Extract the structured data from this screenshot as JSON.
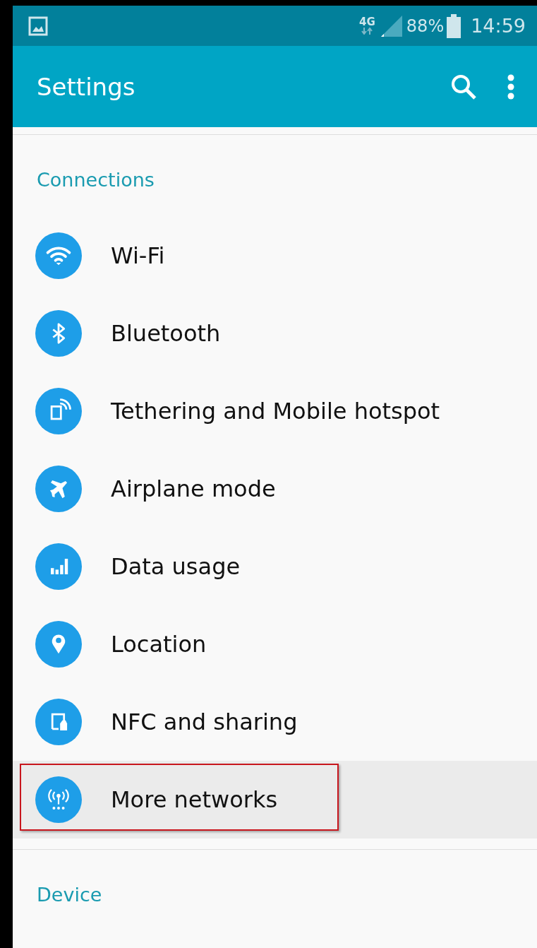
{
  "status_bar": {
    "network": "4G",
    "battery": "88%",
    "time": "14:59"
  },
  "app_bar": {
    "title": "Settings"
  },
  "sections": [
    {
      "title": "Connections",
      "items": [
        {
          "label": "Wi-Fi",
          "selected": false
        },
        {
          "label": "Bluetooth",
          "selected": false
        },
        {
          "label": "Tethering and Mobile hotspot",
          "selected": false
        },
        {
          "label": "Airplane mode",
          "selected": false
        },
        {
          "label": "Data usage",
          "selected": false
        },
        {
          "label": "Location",
          "selected": false
        },
        {
          "label": "NFC and sharing",
          "selected": false
        },
        {
          "label": "More networks",
          "selected": true
        }
      ]
    },
    {
      "title": "Device"
    }
  ]
}
